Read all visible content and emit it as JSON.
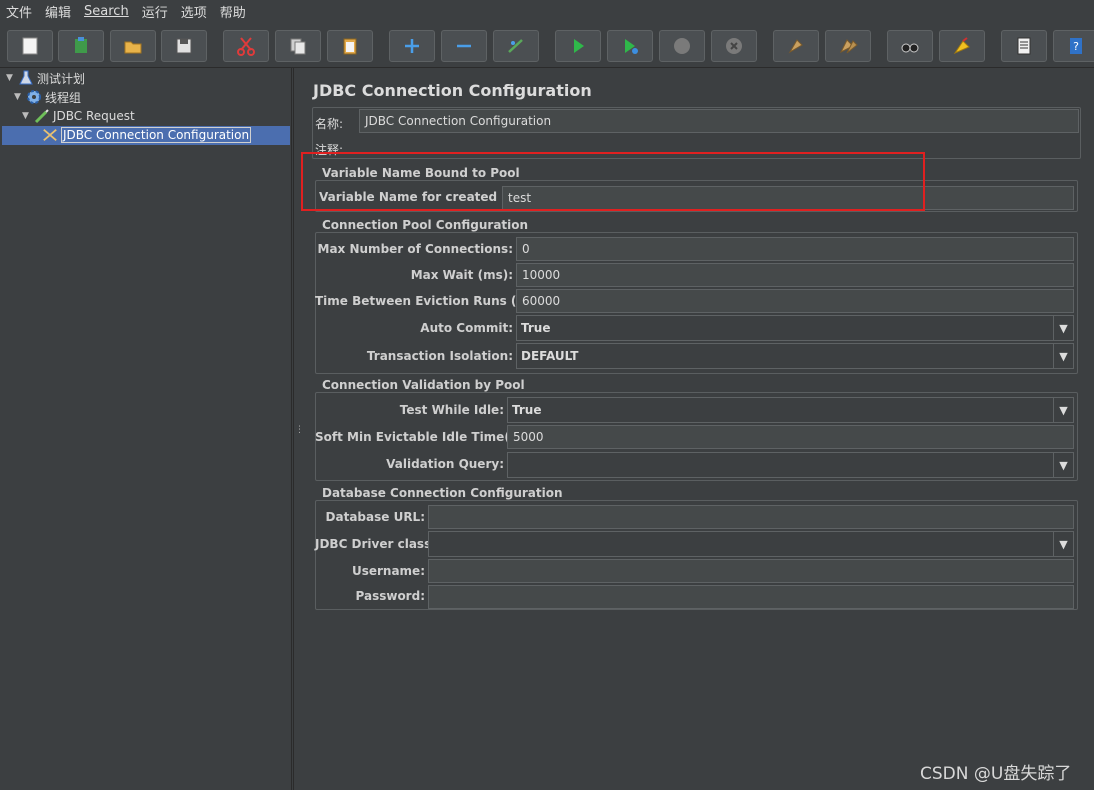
{
  "menu": [
    "文件",
    "编辑",
    "Search",
    "运行",
    "选项",
    "帮助"
  ],
  "toolbar": [
    {
      "name": "new-icon"
    },
    {
      "name": "templates-icon"
    },
    {
      "name": "open-icon"
    },
    {
      "name": "save-icon"
    },
    {
      "name": "cut-icon"
    },
    {
      "name": "copy-icon"
    },
    {
      "name": "paste-icon"
    },
    {
      "name": "expand-icon"
    },
    {
      "name": "collapse-icon"
    },
    {
      "name": "toggle-icon"
    },
    {
      "name": "start-icon"
    },
    {
      "name": "start-no-pause-icon"
    },
    {
      "name": "stop-icon"
    },
    {
      "name": "shutdown-icon"
    },
    {
      "name": "clear-icon"
    },
    {
      "name": "clear-all-icon"
    },
    {
      "name": "search-icon"
    },
    {
      "name": "reset-search-icon"
    },
    {
      "name": "function-helper-icon"
    },
    {
      "name": "help-icon"
    }
  ],
  "tree": {
    "plan": "测试计划",
    "thread_group": "线程组",
    "request": "JDBC Request",
    "config": "JDBC Connection Configuration"
  },
  "main": {
    "title": "JDBC Connection Configuration",
    "name_label": "名称:",
    "name_value": "JDBC Connection Configuration",
    "comment_label": "注释:",
    "comment_value": ""
  },
  "pool_var": {
    "title": "Variable Name Bound to Pool",
    "label": "Variable Name for created pool:",
    "value": "test"
  },
  "pool_config": {
    "title": "Connection Pool Configuration",
    "max_conn_label": "Max Number of Connections:",
    "max_conn_value": "0",
    "max_wait_label": "Max Wait (ms):",
    "max_wait_value": "10000",
    "eviction_label": "Time Between Eviction Runs (ms):",
    "eviction_value": "60000",
    "autocommit_label": "Auto Commit:",
    "autocommit_value": "True",
    "isolation_label": "Transaction Isolation:",
    "isolation_value": "DEFAULT"
  },
  "validation": {
    "title": "Connection Validation by Pool",
    "idle_label": "Test While Idle:",
    "idle_value": "True",
    "soft_min_label": "Soft Min Evictable Idle Time(ms):",
    "soft_min_value": "5000",
    "query_label": "Validation Query:",
    "query_value": ""
  },
  "db": {
    "title": "Database Connection Configuration",
    "url_label": "Database URL:",
    "url_value": "",
    "driver_label": "JDBC Driver class:",
    "driver_value": "",
    "user_label": "Username:",
    "user_value": "",
    "pass_label": "Password:",
    "pass_value": ""
  },
  "watermark": "CSDN @U盘失踪了",
  "colors": {
    "highlight": "#e02020",
    "selection": "#4b6eaf"
  }
}
